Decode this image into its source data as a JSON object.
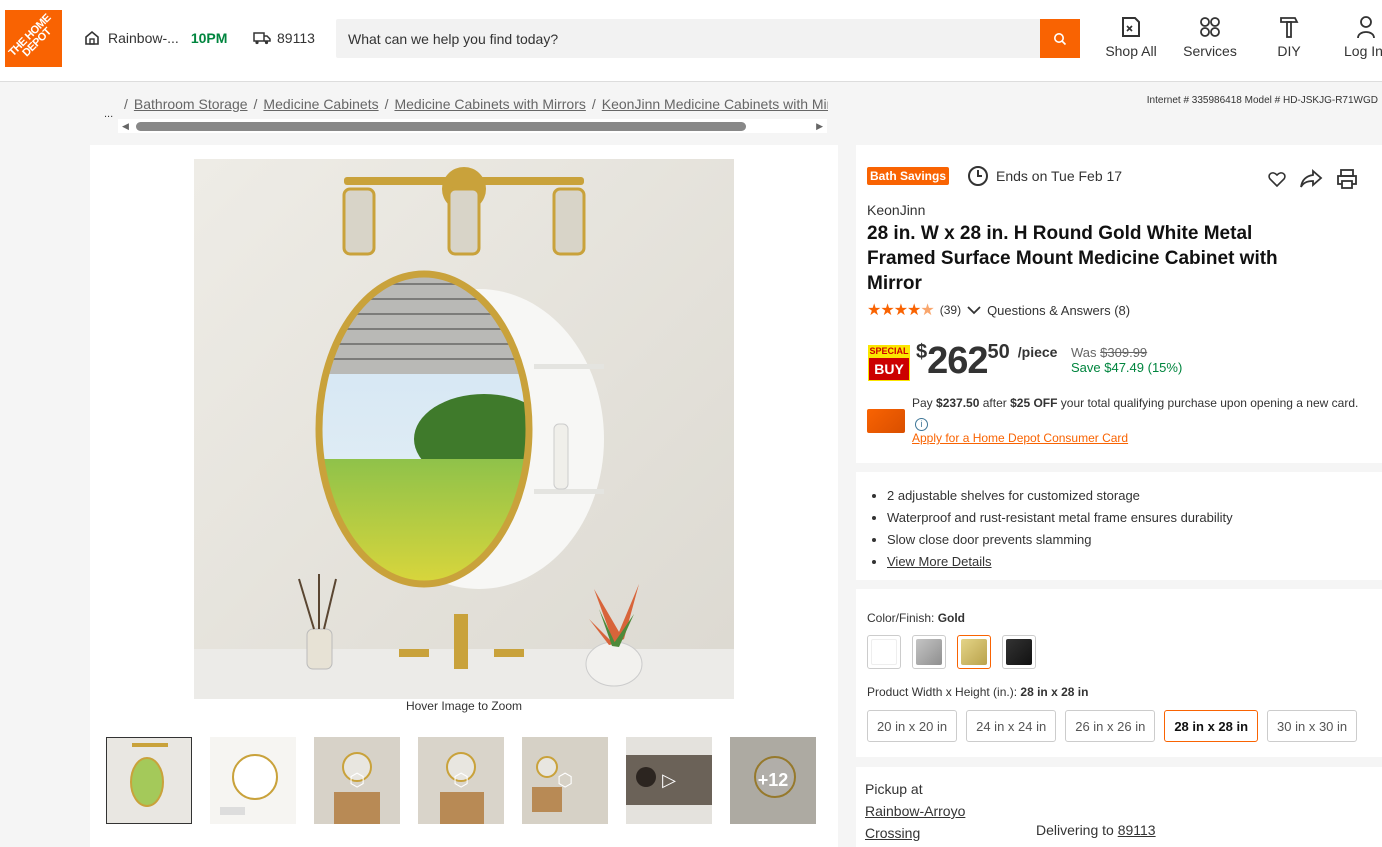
{
  "header": {
    "logo_text": "THE HOME DEPOT",
    "store_name": "Rainbow-...",
    "store_time": "10PM",
    "zip": "89113",
    "search_placeholder": "What can we help you find today?",
    "nav": [
      {
        "label": "Shop All",
        "icon": "catalog-icon"
      },
      {
        "label": "Services",
        "icon": "grid-icon"
      },
      {
        "label": "DIY",
        "icon": "hammer-icon"
      },
      {
        "label": "Log In",
        "icon": "user-icon"
      }
    ]
  },
  "breadcrumb": {
    "ellipsis": "...",
    "items": [
      "Bathroom Storage",
      "Medicine Cabinets",
      "Medicine Cabinets with Mirrors",
      "KeonJinn Medicine Cabinets with Mirrors"
    ]
  },
  "ids": "Internet # 335986418   Model # HD-JSKJG-R71WGD",
  "gallery": {
    "hover_text": "Hover Image to Zoom",
    "more_count": "+12"
  },
  "product": {
    "promo_badge": "Bath Savings",
    "promo_ends": "Ends on Tue Feb 17",
    "brand": "KeonJinn",
    "title": "28 in. W x 28 in. H Round Gold White Metal Framed Surface Mount Medicine Cabinet with Mirror",
    "rating": 4.5,
    "review_count": "(39)",
    "qa_label": "Questions & Answers (8)",
    "special_top": "SPECIAL",
    "special_bottom": "BUY",
    "price_dollar_sign": "$",
    "price_whole": "262",
    "price_cents": "50",
    "price_unit": "/piece",
    "was_label": "Was",
    "was_price": "$309.99",
    "save_text": "Save $47.49 (15%)",
    "card_pay_prefix": "Pay ",
    "card_pay_amount": "$237.50",
    "card_pay_mid": " after ",
    "card_pay_off": "$25 OFF",
    "card_pay_suffix": " your total qualifying purchase upon opening a new card.",
    "card_link": "Apply for a Home Depot Consumer Card"
  },
  "bullets": [
    "2 adjustable shelves for customized storage",
    "Waterproof and rust-resistant metal frame ensures durability",
    "Slow close door prevents slamming"
  ],
  "view_more": "View More Details",
  "options": {
    "color_label": "Color/Finish: ",
    "color_value": "Gold",
    "swatches": [
      {
        "name": "White",
        "color": "#ffffff"
      },
      {
        "name": "Silver",
        "color": "#a9a9a9"
      },
      {
        "name": "Gold",
        "color": "#d4c06a"
      },
      {
        "name": "Black",
        "color": "#1e1e1e"
      }
    ],
    "size_label": "Product Width x Height (in.): ",
    "size_value": "28 in x 28 in",
    "sizes": [
      "20 in x 20 in",
      "24 in x 24 in",
      "26 in x 26 in",
      "28 in x 28 in",
      "30 in x 30 in"
    ]
  },
  "fulfillment": {
    "pickup_label": "Pickup at",
    "store_line1": "Rainbow-Arroyo",
    "store_line2": "Crossing",
    "delivering_label": "Delivering to ",
    "delivering_zip": "89113"
  },
  "colors": {
    "brand_orange": "#f96302",
    "save_green": "#00853e"
  }
}
